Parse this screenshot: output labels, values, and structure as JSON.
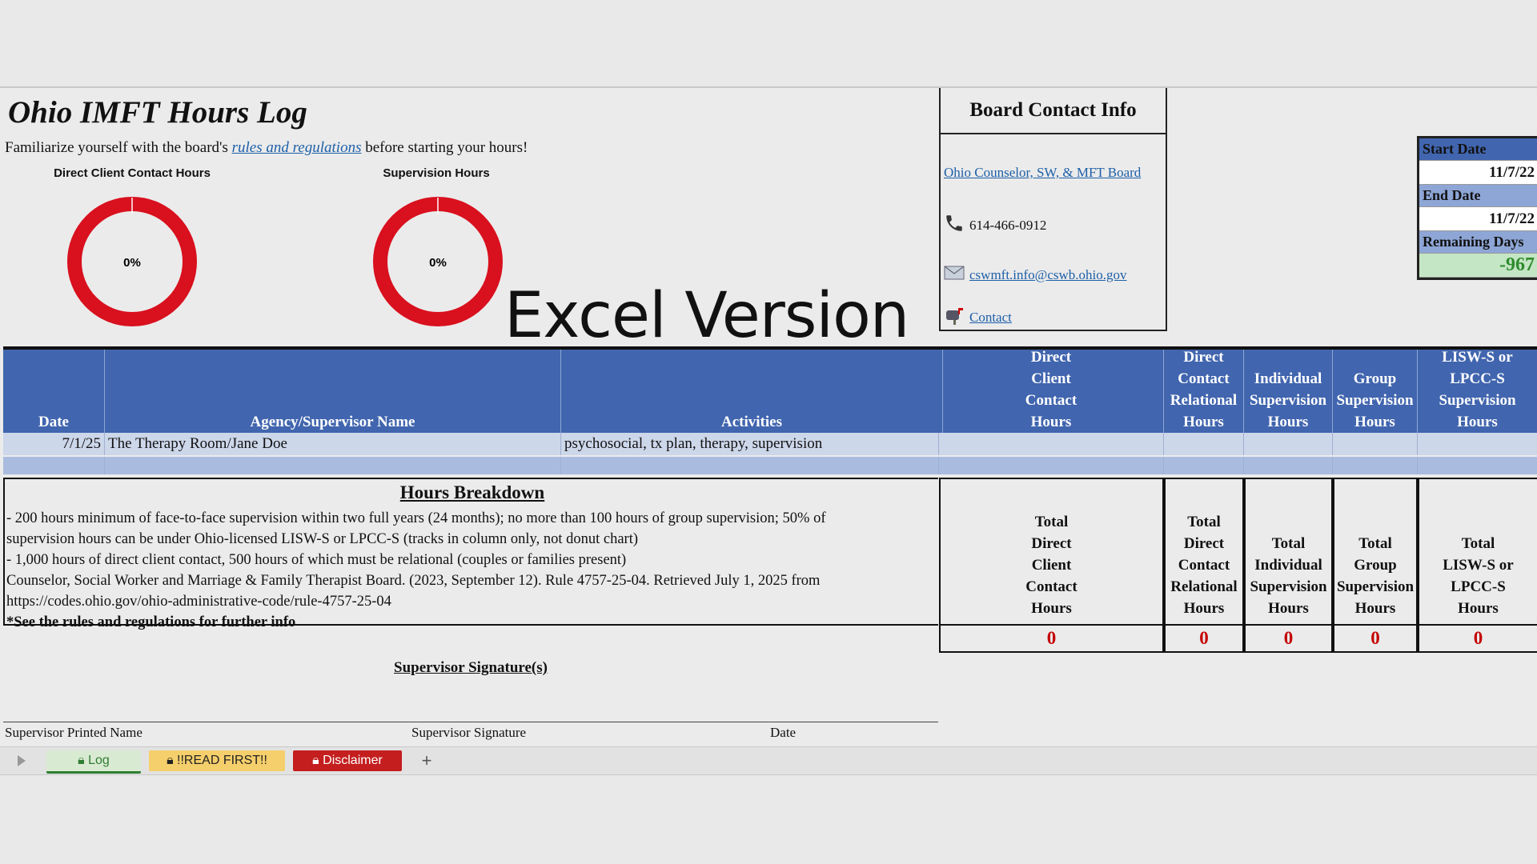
{
  "header": {
    "title": "Ohio IMFT Hours Log",
    "subtitle_pre": "Familiarize yourself with the board's ",
    "subtitle_link": "rules and regulations",
    "subtitle_post": " before starting your hours!",
    "overlay_text": "Excel Version"
  },
  "charts": {
    "direct": {
      "title": "Direct Client Contact Hours",
      "label": "0%"
    },
    "supervision": {
      "title": "Supervision Hours",
      "label": "0%"
    }
  },
  "chart_data": [
    {
      "type": "pie",
      "title": "Direct Client Contact Hours",
      "values": [
        0,
        100
      ],
      "label": "0%"
    },
    {
      "type": "pie",
      "title": "Supervision Hours",
      "values": [
        0,
        100
      ],
      "label": "0%"
    }
  ],
  "contact": {
    "heading": "Board Contact Info",
    "board_link": "Ohio Counselor, SW, & MFT Board",
    "phone": "614-466-0912",
    "email": "cswmft.info@cswb.ohio.gov",
    "contact_link": "Contact"
  },
  "dates": {
    "start_label": "Start Date",
    "start_value": "11/7/22",
    "end_label": "End Date",
    "end_value": "11/7/22",
    "remaining_label": "Remaining Days",
    "remaining_value": "-967"
  },
  "table": {
    "headers": {
      "date": "Date",
      "agency": "Agency/Supervisor Name",
      "activities": "Activities",
      "direct_l1": "Direct",
      "direct_l2": "Client",
      "direct_l3": "Contact",
      "direct_l4": "Hours",
      "relational_l1": "Direct",
      "relational_l2": "Contact",
      "relational_l3": "Relational",
      "relational_l4": "Hours",
      "individual_l1": "Individual",
      "individual_l2": "Supervision",
      "individual_l3": "Hours",
      "group_l1": "Group",
      "group_l2": "Supervision",
      "group_l3": "Hours",
      "lisw_l1": "LISW-S or",
      "lisw_l2": "LPCC-S",
      "lisw_l3": "Supervision",
      "lisw_l4": "Hours"
    },
    "rows": [
      {
        "date": "7/1/25",
        "agency": "The Therapy Room/Jane Doe",
        "activities": "psychosocial, tx plan, therapy, supervision"
      }
    ]
  },
  "breakdown": {
    "title": "Hours Breakdown",
    "line1": "- 200 hours minimum of face-to-face supervision within two full years (24 months); no more than 100 hours of group supervision; 50% of",
    "line2": "supervision hours can be under Ohio-licensed LISW-S or LPCC-S (tracks in column only, not donut chart)",
    "line3": "- 1,000 hours of direct client contact, 500 hours of which must be relational (couples or families present)",
    "line4": "Counselor, Social Worker and Marriage & Family Therapist Board. (2023, September 12). Rule 4757-25-04. Retrieved July 1, 2025 from",
    "line5": "https://codes.ohio.gov/ohio-administrative-code/rule-4757-25-04",
    "line6": "*See the rules and regulations for further info"
  },
  "totals": {
    "direct_l1": "Total",
    "direct_l2": "Direct",
    "direct_l3": "Client",
    "direct_l4": "Contact",
    "direct_l5": "Hours",
    "relational_l1": "Total",
    "relational_l2": "Direct",
    "relational_l3": "Contact",
    "relational_l4": "Relational",
    "relational_l5": "Hours",
    "individual_l1": "Total",
    "individual_l2": "Individual",
    "individual_l3": "Supervision",
    "individual_l4": "Hours",
    "group_l1": "Total",
    "group_l2": "Group",
    "group_l3": "Supervision",
    "group_l4": "Hours",
    "lisw_l1": "Total",
    "lisw_l2": "LISW-S or",
    "lisw_l3": "LPCC-S",
    "lisw_l4": "Hours",
    "values": {
      "direct": "0",
      "relational": "0",
      "individual": "0",
      "group": "0",
      "lisw": "0"
    }
  },
  "signature": {
    "title": "Supervisor Signature(s)",
    "printed_name": "Supervisor Printed Name",
    "signature": "Supervisor Signature",
    "date": "Date"
  },
  "tabs": {
    "log": "Log",
    "read_first": "!!READ FIRST!!",
    "disclaimer": "Disclaimer",
    "add": "+"
  },
  "colors": {
    "header_blue": "#4165ae",
    "donut_red": "#d9101e",
    "total_red": "#c40000",
    "remaining_green": "#2e8b2e"
  }
}
